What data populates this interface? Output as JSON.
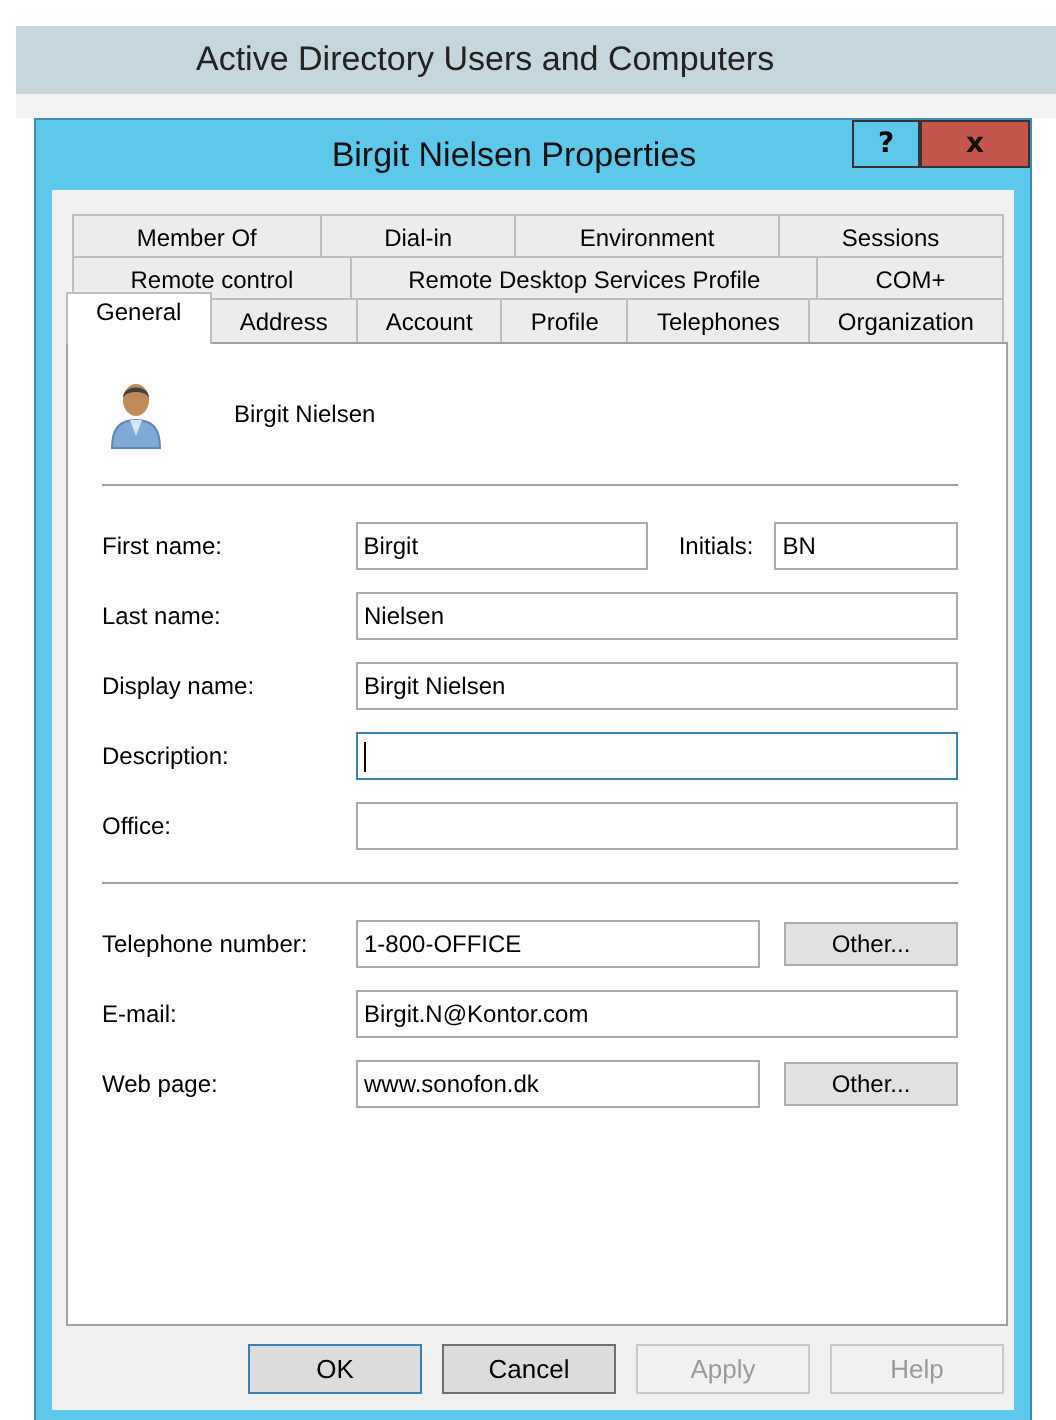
{
  "background_window": {
    "title": "Active Directory Users and Computers"
  },
  "dialog": {
    "title": "Birgit Nielsen Properties",
    "title_buttons": [
      {
        "kind": "help",
        "label": "?"
      },
      {
        "kind": "close",
        "label": "x"
      }
    ]
  },
  "tab_rows": [
    [
      {
        "label": "Member Of",
        "selected": false
      },
      {
        "label": "Dial-in",
        "selected": false
      },
      {
        "label": "Environment",
        "selected": false
      },
      {
        "label": "Sessions",
        "selected": false
      }
    ],
    [
      {
        "label": "Remote control",
        "selected": false
      },
      {
        "label": "Remote Desktop Services Profile",
        "selected": false
      },
      {
        "label": "COM+",
        "selected": false
      }
    ],
    [
      {
        "label": "General",
        "selected": true
      },
      {
        "label": "Address",
        "selected": false
      },
      {
        "label": "Account",
        "selected": false
      },
      {
        "label": "Profile",
        "selected": false
      },
      {
        "label": "Telephones",
        "selected": false
      },
      {
        "label": "Organization",
        "selected": false
      }
    ]
  ],
  "user": {
    "name": "Birgit Nielsen"
  },
  "field_groups": [
    [
      {
        "kind": "initials",
        "label": "First name:",
        "value": "Birgit",
        "focused": false,
        "extra_label": "Initials:",
        "extra_value": "BN"
      },
      {
        "kind": "text",
        "label": "Last name:",
        "value": "Nielsen",
        "focused": false
      },
      {
        "kind": "text",
        "label": "Display name:",
        "value": "Birgit Nielsen",
        "focused": false
      },
      {
        "kind": "text",
        "label": "Description:",
        "focused": true
      },
      {
        "kind": "text",
        "label": "Office:",
        "focused": false
      }
    ],
    [
      {
        "kind": "button",
        "label": "Telephone number:",
        "value": "1-800-OFFICE",
        "focused": false,
        "button": "Other..."
      },
      {
        "kind": "text",
        "label": "E-mail:",
        "value": "Birgit.N@Kontor.com",
        "focused": false
      },
      {
        "kind": "button",
        "label": "Web page:",
        "value": "www.sonofon.dk",
        "focused": false,
        "button": "Other..."
      }
    ]
  ],
  "buttons": [
    {
      "label": "OK",
      "default": true,
      "disabled": false
    },
    {
      "label": "Cancel",
      "default": false,
      "disabled": false
    },
    {
      "label": "Apply",
      "default": false,
      "disabled": true
    },
    {
      "label": "Help",
      "default": false,
      "disabled": true
    }
  ]
}
